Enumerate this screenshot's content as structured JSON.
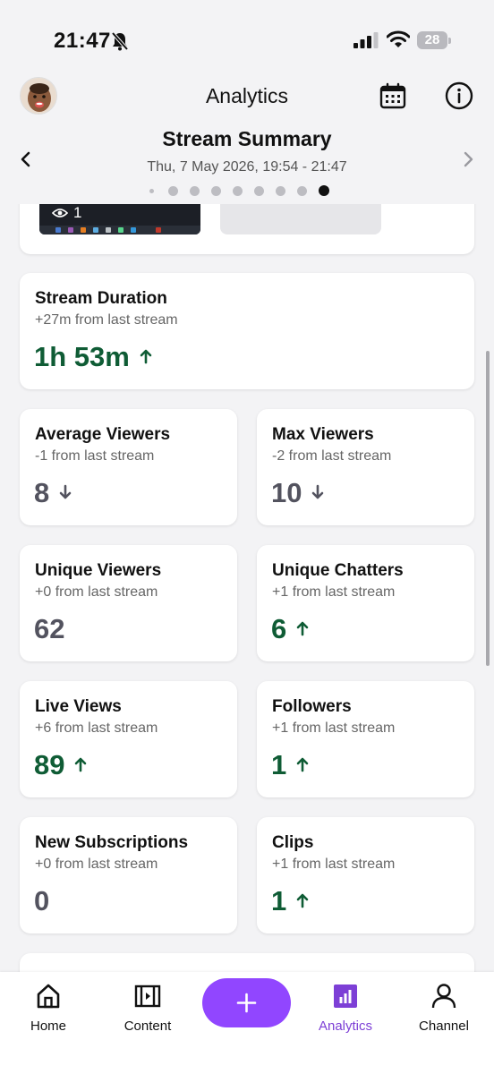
{
  "status_bar": {
    "time": "21:47",
    "battery": "28"
  },
  "header": {
    "title": "Analytics"
  },
  "summary": {
    "title": "Stream Summary",
    "date_range": "Thu, 7 May 2026, 19:54 - 21:47",
    "page_count": 9,
    "active_page": 9
  },
  "thumbnail": {
    "view_count": "1"
  },
  "metrics": [
    {
      "title": "Stream Duration",
      "delta": "+27m from last stream",
      "value": "1h 53m",
      "trend": "up"
    },
    {
      "title": "Average Viewers",
      "delta": "-1 from last stream",
      "value": "8",
      "trend": "down"
    },
    {
      "title": "Max Viewers",
      "delta": "-2 from last stream",
      "value": "10",
      "trend": "down"
    },
    {
      "title": "Unique Viewers",
      "delta": "+0 from last stream",
      "value": "62",
      "trend": "neutral"
    },
    {
      "title": "Unique Chatters",
      "delta": "+1 from last stream",
      "value": "6",
      "trend": "up"
    },
    {
      "title": "Live Views",
      "delta": "+6 from last stream",
      "value": "89",
      "trend": "up"
    },
    {
      "title": "Followers",
      "delta": "+1 from last stream",
      "value": "1",
      "trend": "up"
    },
    {
      "title": "New Subscriptions",
      "delta": "+0 from last stream",
      "value": "0",
      "trend": "neutral"
    },
    {
      "title": "Clips",
      "delta": "+1 from last stream",
      "value": "1",
      "trend": "up"
    }
  ],
  "bottom_nav": {
    "home": "Home",
    "content": "Content",
    "analytics": "Analytics",
    "channel": "Channel",
    "active": "analytics"
  },
  "colors": {
    "accent": "#9146ff",
    "positive": "#0f5c35",
    "neutral": "#53535f",
    "active_nav": "#7d3fd6"
  },
  "icons": {
    "bell": "bell-slash-icon",
    "calendar": "calendar-icon",
    "info": "info-icon",
    "prev": "chevron-left-icon",
    "next": "chevron-right-icon",
    "eye": "eye-icon",
    "home": "home-icon",
    "content": "film-icon",
    "create": "plus-icon",
    "analytics": "bar-chart-icon",
    "channel": "user-icon"
  }
}
